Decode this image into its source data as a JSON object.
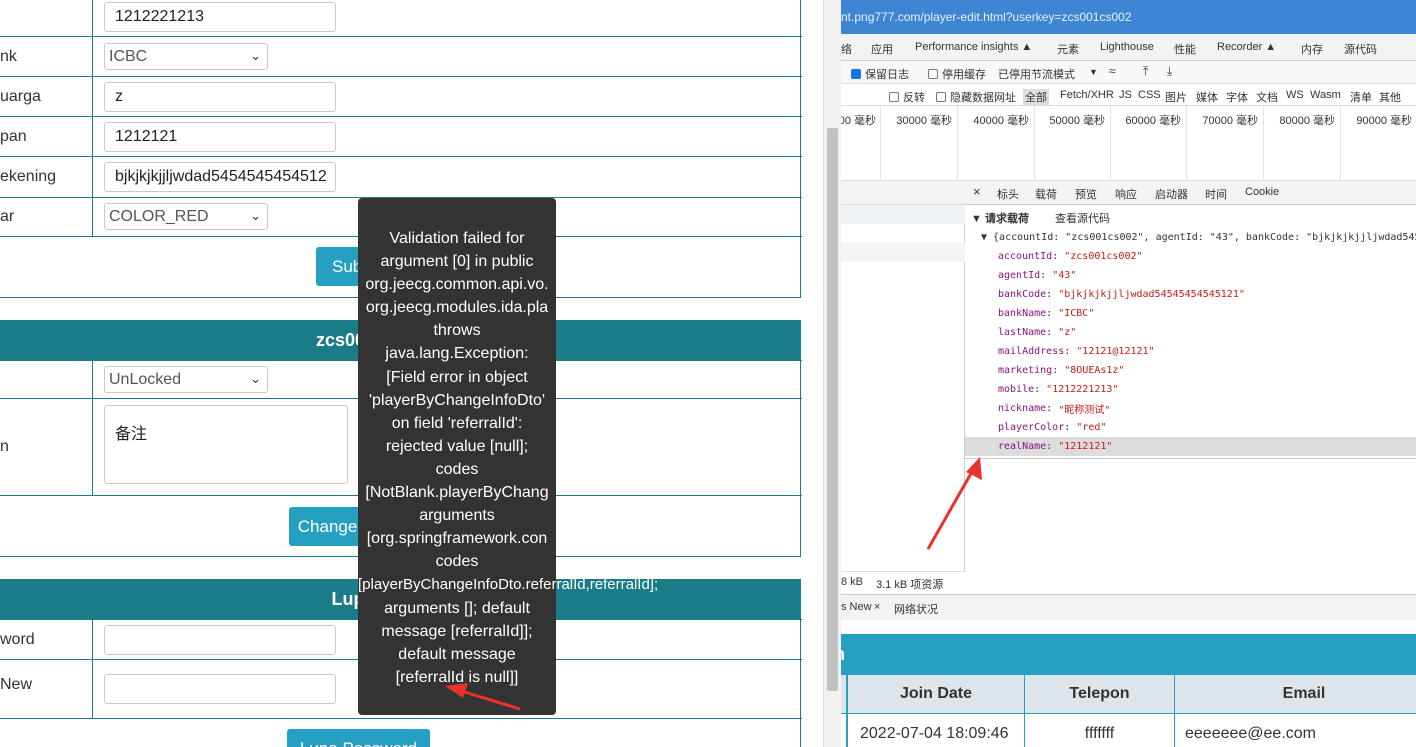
{
  "form1": {
    "rows": [
      {
        "label": "",
        "value": "1212221213",
        "kind": "input"
      },
      {
        "label": "nk",
        "value": "ICBC",
        "kind": "select"
      },
      {
        "label": "uarga",
        "value": "z",
        "kind": "input"
      },
      {
        "label": "pan",
        "value": "1212121",
        "kind": "input"
      },
      {
        "label": "ekening",
        "value": "bjkjkjkjjljwdad5454545454512",
        "kind": "input"
      },
      {
        "label": "ar",
        "value": "COLOR_RED",
        "kind": "select"
      }
    ],
    "submit_label": "Submit"
  },
  "status_section": {
    "title": "zcs001cs002Status",
    "status_value": "UnLocked",
    "note_label": "n",
    "note_value": "备注",
    "button_label": "Change Status"
  },
  "password_section": {
    "title": "Lupa Password",
    "rows": [
      {
        "label": "word",
        "value": ""
      },
      {
        "label": "New",
        "value": ""
      }
    ],
    "button_label": "Lupa Password"
  },
  "tooltip": {
    "lines": [
      "Validation failed for",
      "argument [0] in public",
      "org.jeecg.common.api.vo.",
      "org.jeecg.modules.ida.pla",
      "throws",
      "java.lang.Exception:",
      "[Field error in object",
      "'playerByChangeInfoDto'",
      "on field 'referralId':",
      "rejected value [null];",
      "codes",
      "[NotBlank.playerByChang",
      "arguments",
      "[org.springframework.con",
      "codes",
      "[playerByChangeInfoDto.referralId,referralId];",
      "arguments []; default",
      "message [referralId]];",
      "default message",
      "[referralId is null]]"
    ]
  },
  "devtools": {
    "url": "nt.png777.com/player-edit.html?userkey=zcs001cs002",
    "tabs": [
      "络",
      "应用",
      "Performance insights ▲",
      "元素",
      "Lighthouse",
      "性能",
      "Recorder ▲",
      "内存",
      "源代码"
    ],
    "toolbar": {
      "preserve_log": "保留日志",
      "disable_cache": "停用缓存",
      "throttle": "已停用节流模式"
    },
    "filters": [
      "反转",
      "隐藏数据网址",
      "全部",
      "Fetch/XHR",
      "JS",
      "CSS",
      "图片",
      "媒体",
      "字体",
      "文档",
      "WS",
      "Wasm",
      "清单",
      "其他"
    ],
    "timeline_ticks": [
      "00 毫秒",
      "30000 毫秒",
      "40000 毫秒",
      "50000 毫秒",
      "60000 毫秒",
      "70000 毫秒",
      "80000 毫秒",
      "90000 毫秒"
    ],
    "detail_tabs": [
      "×",
      "标头",
      "载荷",
      "预览",
      "响应",
      "启动器",
      "时间",
      "Cookie"
    ],
    "payload_header": "▼ 请求载荷",
    "view_source": "查看源代码",
    "payload_summary": "▼ {accountId: \"zcs001cs002\", agentId: \"43\", bankCode: \"bjkjkjkjjljwdad5454",
    "payload_fields": [
      {
        "key": "accountId",
        "value": "\"zcs001cs002\""
      },
      {
        "key": "agentId",
        "value": "\"43\""
      },
      {
        "key": "bankCode",
        "value": "\"bjkjkjkjjljwdad54545454545121\""
      },
      {
        "key": "bankName",
        "value": "\"ICBC\""
      },
      {
        "key": "lastName",
        "value": "\"z\""
      },
      {
        "key": "mailAddress",
        "value": "\"12121@12121\""
      },
      {
        "key": "marketing",
        "value": "\"8OUEAs1z\""
      },
      {
        "key": "mobile",
        "value": "\"1212221213\""
      },
      {
        "key": "nickname",
        "value": "\"昵称测试\""
      },
      {
        "key": "playerColor",
        "value": "\"red\""
      },
      {
        "key": "realName",
        "value": "\"1212121\""
      }
    ],
    "status_left": "8 kB",
    "status_resources": "3.1 kB 项资源",
    "drawer_tab": "s New",
    "drawer_close": "×",
    "drawer_other": "网络状况"
  },
  "right_page": {
    "band_title": "in",
    "columns": [
      "",
      "Join Date",
      "Telepon",
      "Email"
    ],
    "row": [
      "",
      "2022-07-04 18:09:46",
      "fffffff",
      "eeeeeee@ee.com"
    ]
  },
  "colors": {
    "teal": "#1a7c86",
    "button": "#26a0c0",
    "tooltip_bg": "#333333",
    "arrow": "#e8322a",
    "url_bar": "#3e86d4"
  }
}
